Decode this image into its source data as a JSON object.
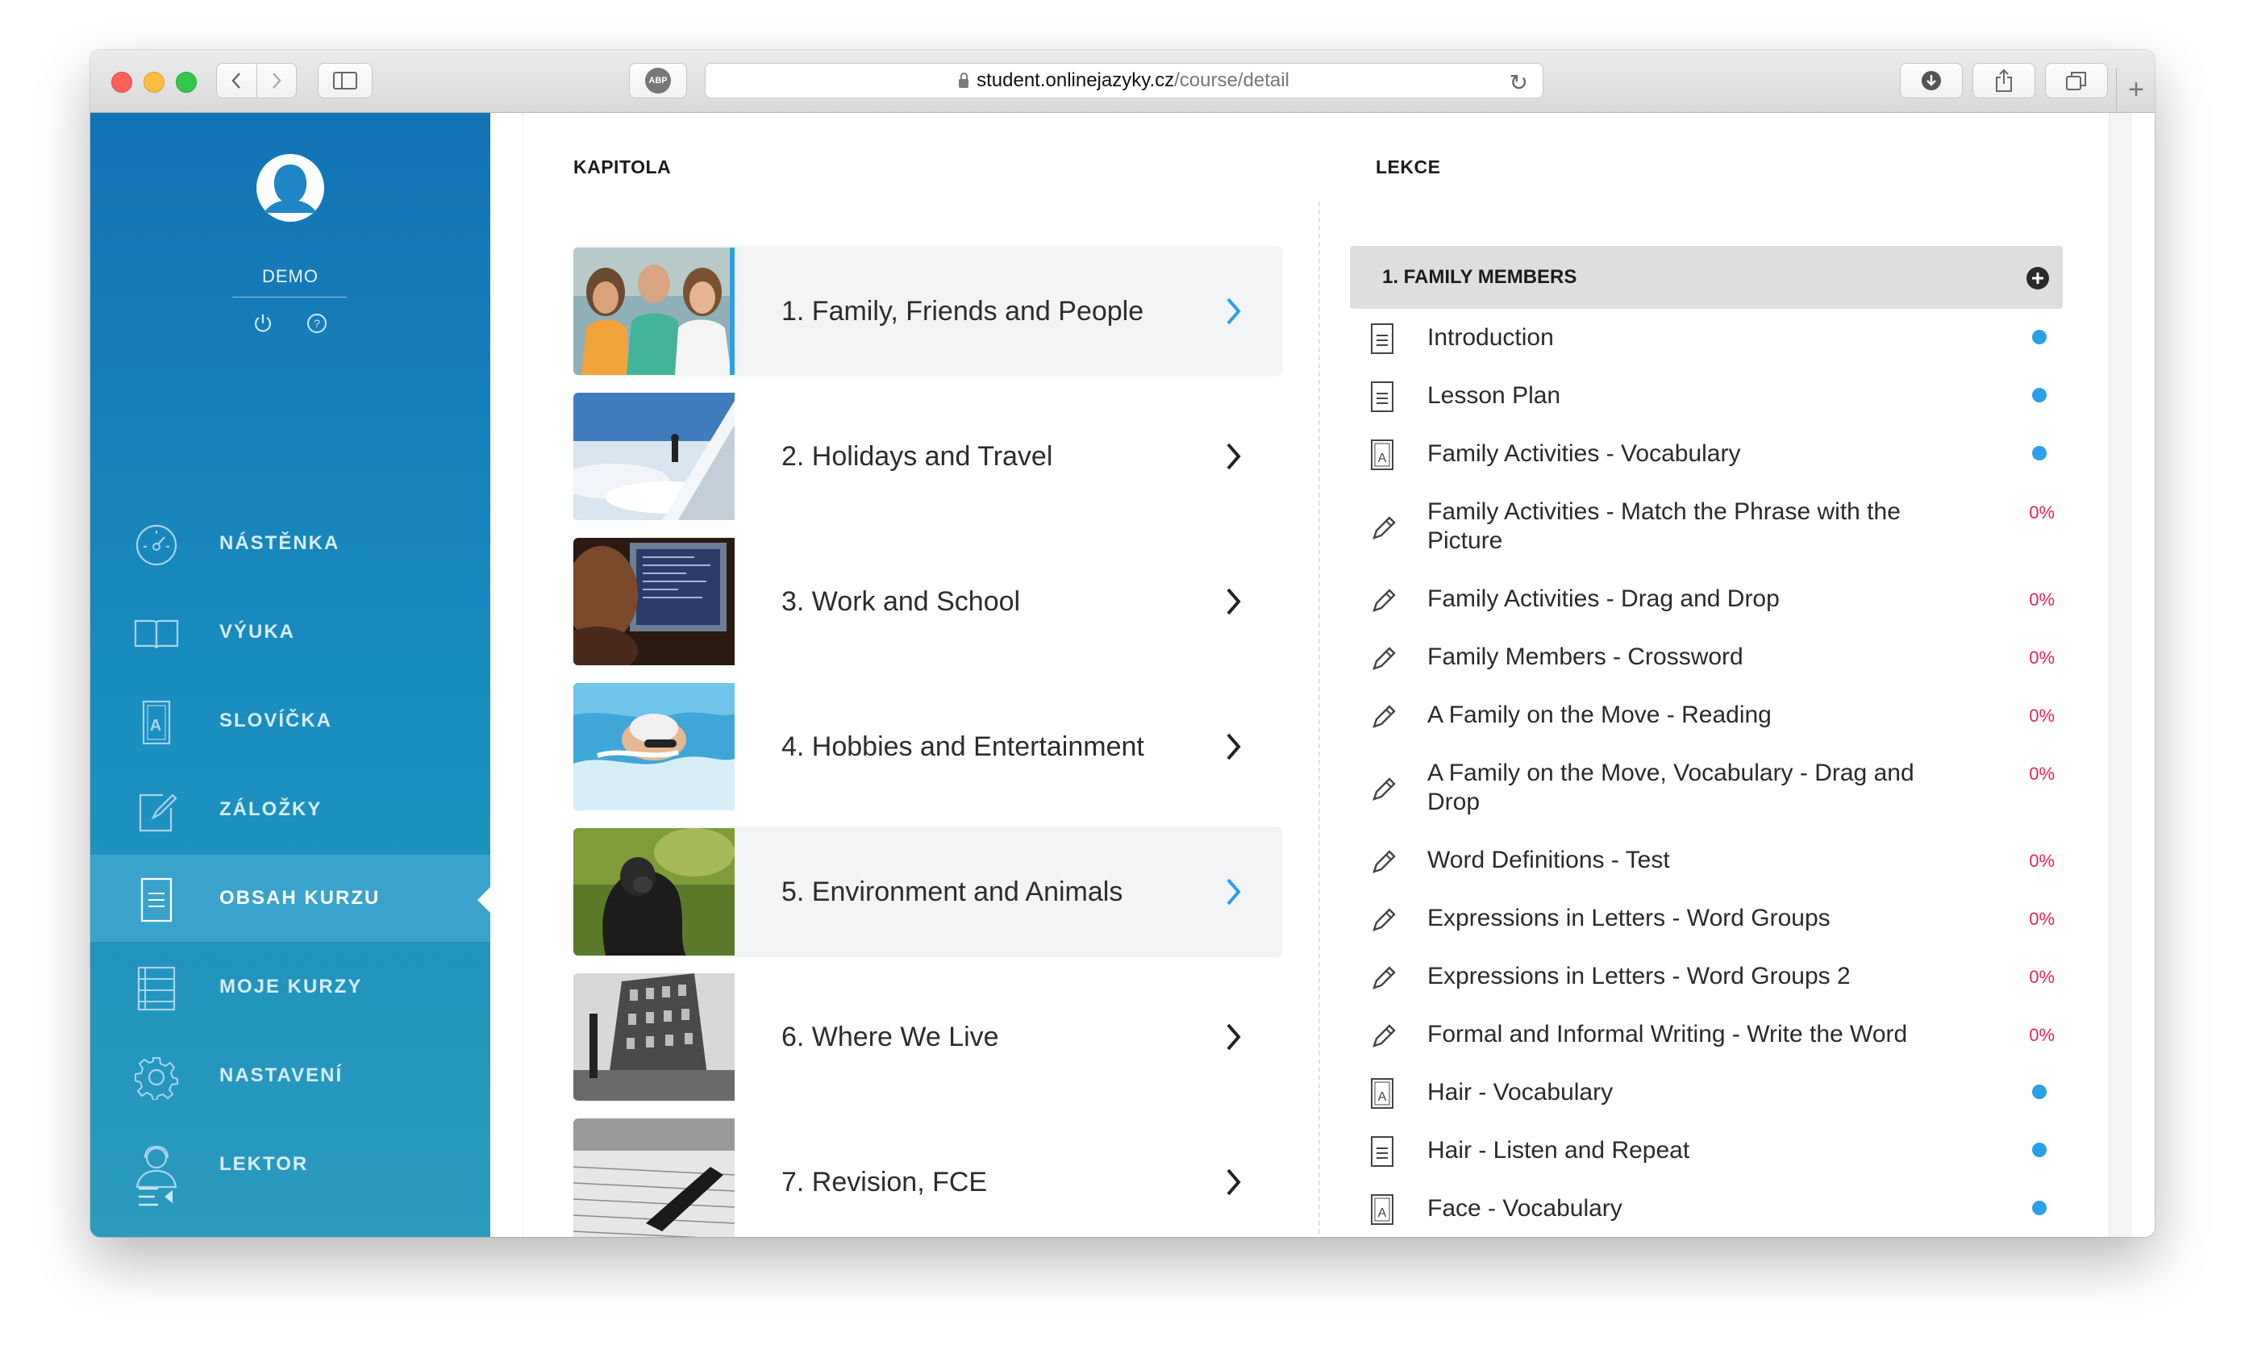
{
  "browser": {
    "url_host": "student.onlinejazyky.cz",
    "url_path": "/course/detail",
    "adblock_label": "ABP"
  },
  "sidebar": {
    "user_name": "DEMO",
    "nav": [
      {
        "label": "NÁSTĚNKA",
        "icon": "dashboard-icon"
      },
      {
        "label": "VÝUKA",
        "icon": "book-icon"
      },
      {
        "label": "SLOVÍČKA",
        "icon": "vocabulary-icon"
      },
      {
        "label": "ZÁLOŽKY",
        "icon": "bookmark-edit-icon"
      },
      {
        "label": "OBSAH KURZU",
        "icon": "document-icon",
        "active": true
      },
      {
        "label": "MOJE KURZY",
        "icon": "courses-list-icon"
      },
      {
        "label": "NASTAVENÍ",
        "icon": "gear-icon"
      },
      {
        "label": "LEKTOR",
        "icon": "tutor-icon"
      }
    ]
  },
  "chapters": {
    "heading": "KAPITOLA",
    "items": [
      {
        "label": "1. Family, Friends and People",
        "chevron_color": "#2b9fe8",
        "highlight": true
      },
      {
        "label": "2. Holidays and Travel",
        "chevron_color": "#222222",
        "highlight": false
      },
      {
        "label": "3. Work and School",
        "chevron_color": "#222222",
        "highlight": false
      },
      {
        "label": "4. Hobbies and Entertainment",
        "chevron_color": "#222222",
        "highlight": false
      },
      {
        "label": "5. Environment and Animals",
        "chevron_color": "#2b9fe8",
        "highlight": true
      },
      {
        "label": "6. Where We Live",
        "chevron_color": "#222222",
        "highlight": false
      },
      {
        "label": "7. Revision, FCE",
        "chevron_color": "#222222",
        "highlight": false
      }
    ]
  },
  "lessons": {
    "heading": "LEKCE",
    "group_title": "1. FAMILY MEMBERS",
    "items": [
      {
        "label": "Introduction",
        "icon": "document-icon",
        "status": "dot"
      },
      {
        "label": "Lesson Plan",
        "icon": "document-icon",
        "status": "dot"
      },
      {
        "label": "Family Activities - Vocabulary",
        "icon": "vocabulary-icon",
        "status": "dot"
      },
      {
        "label": "Family Activities - Match the Phrase with the Picture",
        "icon": "pencil-icon",
        "status": "0%"
      },
      {
        "label": "Family Activities - Drag and Drop",
        "icon": "pencil-icon",
        "status": "0%"
      },
      {
        "label": "Family Members - Crossword",
        "icon": "pencil-icon",
        "status": "0%"
      },
      {
        "label": "A Family on the Move - Reading",
        "icon": "pencil-icon",
        "status": "0%"
      },
      {
        "label": "A Family on the Move, Vocabulary - Drag and Drop",
        "icon": "pencil-icon",
        "status": "0%"
      },
      {
        "label": "Word Definitions - Test",
        "icon": "pencil-icon",
        "status": "0%"
      },
      {
        "label": "Expressions in Letters - Word Groups",
        "icon": "pencil-icon",
        "status": "0%"
      },
      {
        "label": "Expressions in Letters - Word Groups 2",
        "icon": "pencil-icon",
        "status": "0%"
      },
      {
        "label": "Formal and Informal Writing - Write the Word",
        "icon": "pencil-icon",
        "status": "0%"
      },
      {
        "label": "Hair - Vocabulary",
        "icon": "vocabulary-icon",
        "status": "dot"
      },
      {
        "label": "Hair - Listen and Repeat",
        "icon": "document-icon",
        "status": "dot"
      },
      {
        "label": "Face - Vocabulary",
        "icon": "vocabulary-icon",
        "status": "dot"
      }
    ]
  },
  "colors": {
    "accent": "#2b9fe8",
    "progress_zero": "#e2265a",
    "sidebar_top": "#1273b5",
    "sidebar_active": "#3aa3cc"
  }
}
